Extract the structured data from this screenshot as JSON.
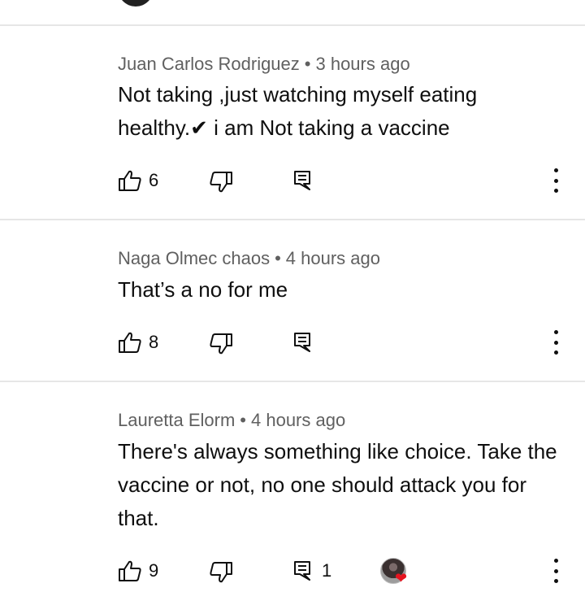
{
  "comments": [
    {
      "author": "Juan Carlos Rodriguez",
      "time": "3 hours ago",
      "text": "Not taking ,just watching myself eating healthy.✔ i am Not taking a vaccine",
      "likes": "6",
      "replies": ""
    },
    {
      "author": "Naga Olmec chaos",
      "time": "4 hours ago",
      "text": "That’s a no for me",
      "likes": "8",
      "replies": ""
    },
    {
      "author": "Lauretta Elorm",
      "time": "4 hours ago",
      "text": "There's always something like choice. Take the vaccine or not, no one should attack you for that.",
      "likes": "9",
      "replies": "1"
    }
  ],
  "separator": "•",
  "icons": {
    "like": "thumbs-up-icon",
    "dislike": "thumbs-down-icon",
    "reply": "reply-icon",
    "more": "more-vertical-icon",
    "creator_heart": "heart-icon"
  },
  "colors": {
    "text": "#0f0f0f",
    "meta": "#606060",
    "divider": "#e6e6e6",
    "heart": "#e5131f"
  }
}
